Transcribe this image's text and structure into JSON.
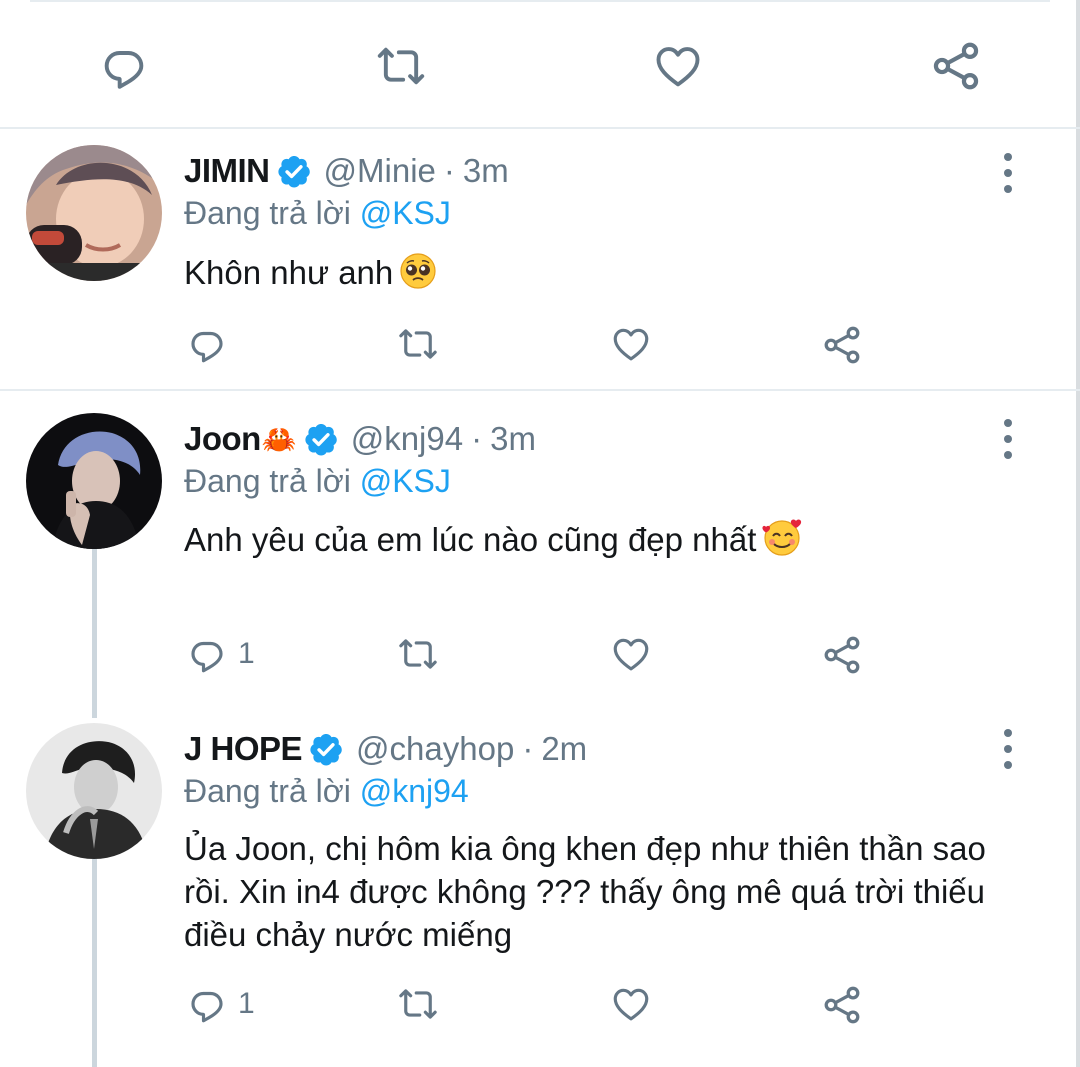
{
  "colors": {
    "accent": "#1da1f2",
    "muted": "#657786",
    "text": "#14171a",
    "divider": "#e6ecf0"
  },
  "top_actions": {
    "icons": [
      "reply-icon",
      "retweet-icon",
      "like-icon",
      "share-icon"
    ]
  },
  "tweets": [
    {
      "name": "JIMIN",
      "handle": "@Minie",
      "separator": "·",
      "time": "3m",
      "replying_prefix": "Đang trả lời",
      "replying_to": "@KSJ",
      "text": "Khôn như anh",
      "emoji": "pleading-face-emoji",
      "reply_count": ""
    },
    {
      "name": "Joon",
      "name_emoji": "🦀",
      "handle": "@knj94",
      "separator": "·",
      "time": "3m",
      "replying_prefix": "Đang trả lời",
      "replying_to": "@KSJ",
      "text": "Anh yêu của em lúc nào cũng đẹp nhất",
      "emoji": "smiling-face-with-hearts-emoji",
      "reply_count": "1"
    },
    {
      "name": "J HOPE",
      "handle": "@chayhop",
      "separator": "·",
      "time": "2m",
      "replying_prefix": "Đang trả lời",
      "replying_to": "@knj94",
      "text": "Ủa Joon, chị hôm kia ông khen đẹp như thiên thần sao rồi. Xin in4 được không ??? thấy ông mê quá trời thiếu điều chảy nước miếng",
      "reply_count": "1"
    }
  ]
}
